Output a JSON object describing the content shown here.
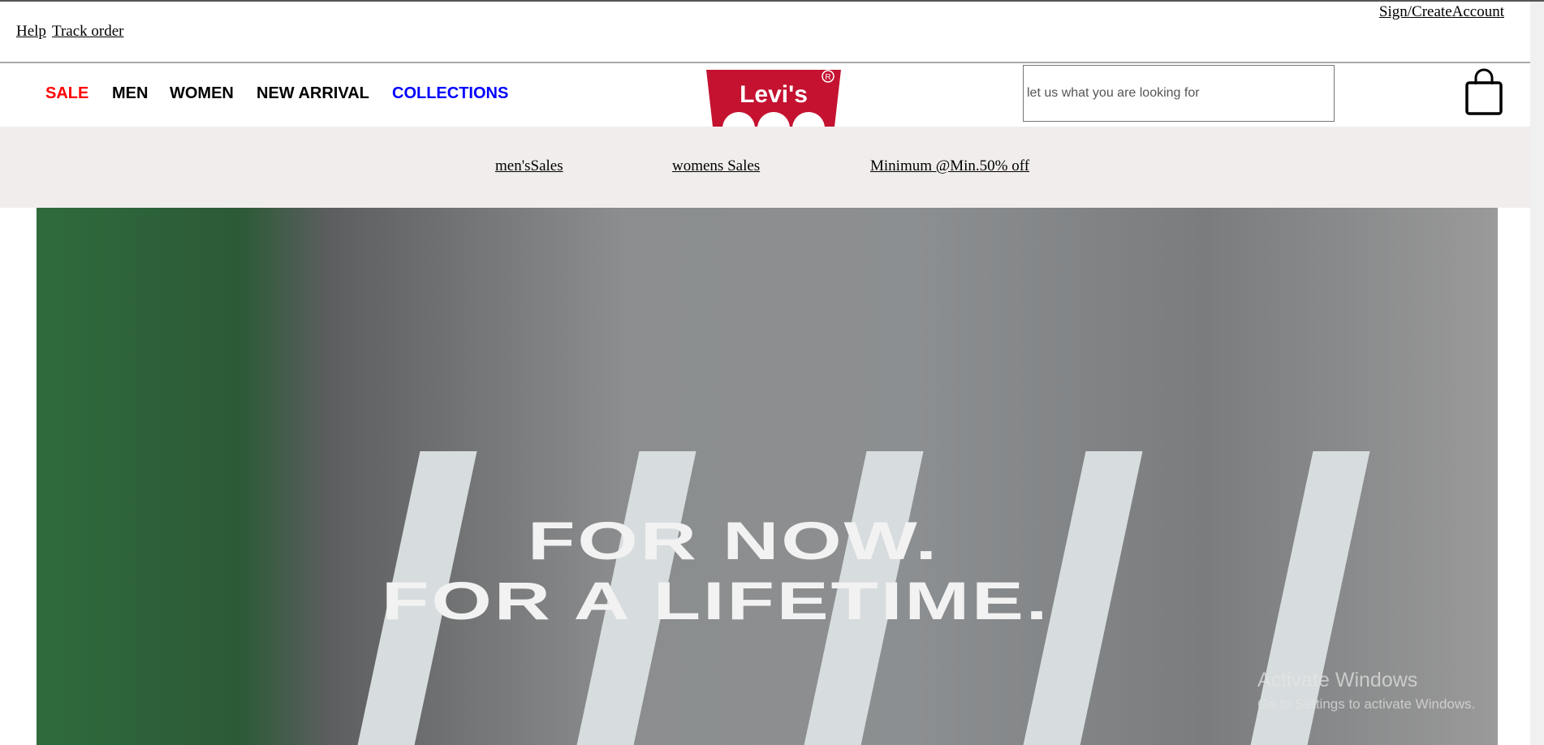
{
  "topbar": {
    "sign": "Sign/CreateAccount",
    "help": "Help",
    "track": "Track order"
  },
  "nav": {
    "items": [
      {
        "label": "SALE",
        "color": "#ff0000"
      },
      {
        "label": "MEN",
        "color": "#000000"
      },
      {
        "label": "WOMEN",
        "color": "#000000"
      },
      {
        "label": "NEW ARRIVAL",
        "color": "#000000"
      },
      {
        "label": "COLLECTIONS",
        "color": "#0000ff"
      }
    ],
    "logo": "Levi's",
    "search_placeholder": "let us what you are looking for"
  },
  "sale_bar": {
    "links": [
      "men'sSales ",
      "womens Sales",
      "Minimum @Min.50% off"
    ]
  },
  "hero": {
    "line1": "FOR NOW.",
    "line2": "FOR A LIFETIME."
  },
  "watermark": {
    "title": "Activate Windows",
    "subtitle": "Go to Settings to activate Windows."
  }
}
